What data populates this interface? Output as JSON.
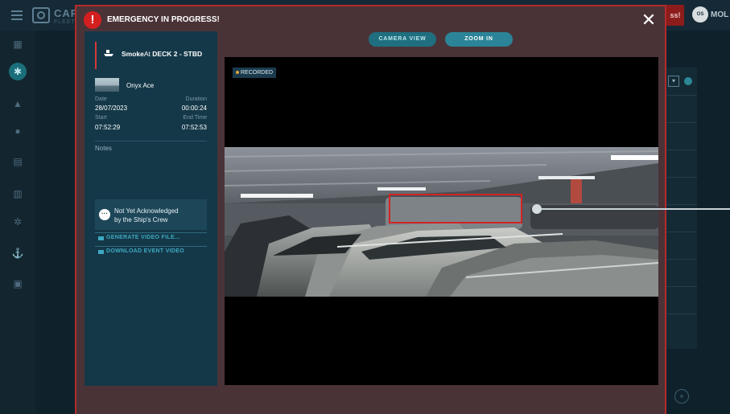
{
  "app": {
    "title": "CAPTA",
    "subtitle": "FLEET",
    "alert_chip": "ss!",
    "user_initials": "OS",
    "user_name": "MOL"
  },
  "sidebar": {
    "items": [
      {
        "name": "dashboard",
        "icon": "grid-icon"
      },
      {
        "name": "events",
        "icon": "alarm-icon",
        "active": true
      },
      {
        "name": "alerts",
        "icon": "bell-icon"
      },
      {
        "name": "info",
        "icon": "info-icon"
      },
      {
        "name": "reports",
        "icon": "document-icon"
      },
      {
        "name": "analytics",
        "icon": "chart-icon"
      },
      {
        "name": "settings",
        "icon": "gear-icon"
      },
      {
        "name": "ships",
        "icon": "ship-icon"
      },
      {
        "name": "users",
        "icon": "user-icon"
      }
    ]
  },
  "modal": {
    "title": "EMERGENCY IN PROGRESS!",
    "close_label": "✕",
    "event": {
      "type": "Smoke",
      "at": "At",
      "location": "DECK 2 - STBD"
    },
    "ship_name": "Onyx Ace",
    "date_label": "Date",
    "date": "28/07/2023",
    "duration_label": "Duration",
    "duration": "00:00:24",
    "start_label": "Start",
    "start": "07:52:29",
    "end_label": "End Time",
    "end": "07:52:53",
    "notes_label": "Notes",
    "ack_line1": "Not Yet Acknowledged",
    "ack_line2": "by the Ship's Crew",
    "generate_video": "GENERATE VIDEO FILE...",
    "download_video": "DOWNLOAD EVENT VIDEO",
    "camera_view": "CAMERA VIEW",
    "zoom_in": "ZOOM IN",
    "recorded_badge": "RECORDED"
  },
  "colors": {
    "alert_red": "#d41f1f",
    "accent_teal": "#2b8497",
    "panel": "#143848",
    "modal_bg": "#4a3337"
  }
}
